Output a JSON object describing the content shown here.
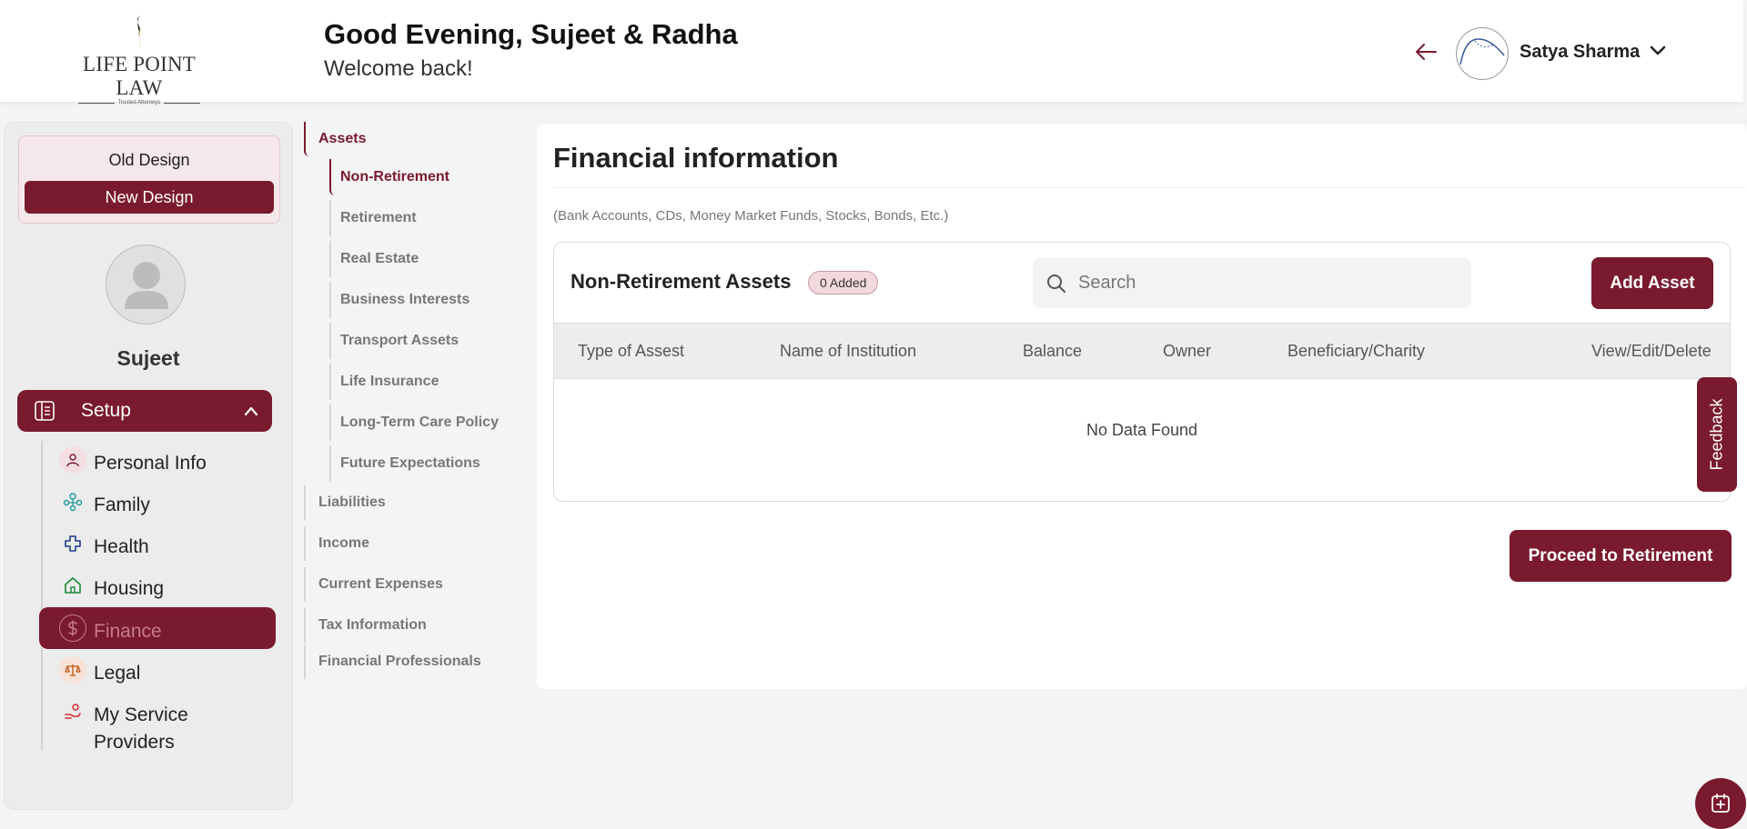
{
  "header": {
    "logo_text": "LIFE POINT LAW",
    "logo_tagline": "Trusted Attorneys",
    "greeting": "Good Evening, Sujeet & Radha",
    "welcome": "Welcome back!",
    "user_name": "Satya Sharma"
  },
  "sidebar": {
    "old_design": "Old Design",
    "new_design": "New Design",
    "profile_name": "Sujeet",
    "setup_label": "Setup",
    "items": [
      {
        "label": "Personal Info",
        "icon": "person-icon"
      },
      {
        "label": "Family",
        "icon": "family-icon"
      },
      {
        "label": "Health",
        "icon": "health-cross-icon"
      },
      {
        "label": "Housing",
        "icon": "home-icon"
      },
      {
        "label": "Finance",
        "icon": "dollar-icon",
        "active": true
      },
      {
        "label": "Legal",
        "icon": "scales-icon"
      },
      {
        "label": "My Service Providers",
        "icon": "service-hand-icon"
      }
    ]
  },
  "subnav": {
    "assets": "Assets",
    "children": [
      "Non-Retirement",
      "Retirement",
      "Real Estate",
      "Business Interests",
      "Transport Assets",
      "Life Insurance",
      "Long-Term Care Policy",
      "Future Expectations"
    ],
    "others": [
      "Liabilities",
      "Income",
      "Current Expenses",
      "Tax Information",
      "Financial Professionals"
    ]
  },
  "main": {
    "title": "Financial information",
    "subtitle": "(Bank Accounts, CDs, Money Market Funds, Stocks, Bonds, Etc.)",
    "table_title": "Non-Retirement Assets",
    "badge": "0 Added",
    "search_placeholder": "Search",
    "add_button": "Add Asset",
    "columns": [
      "Type of Assest",
      "Name of Institution",
      "Balance",
      "Owner",
      "Beneficiary/Charity",
      "View/Edit/Delete"
    ],
    "empty": "No Data Found",
    "proceed_button": "Proceed to Retirement"
  },
  "feedback": "Feedback",
  "colors": {
    "brand": "#7a1a2e",
    "badge_bg": "#f2d9dd"
  }
}
